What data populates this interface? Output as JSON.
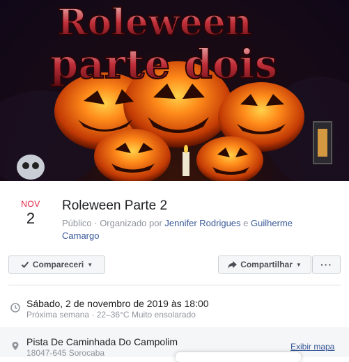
{
  "cover": {
    "title_line1": "Roleween",
    "title_line2": "parte dois"
  },
  "event": {
    "month": "NOV",
    "day": "2",
    "title": "Roleween Parte 2",
    "privacy": "Público · Organizado por ",
    "host1": "Jennifer Rodrigues",
    "and": " e ",
    "host2": "Guilherme Camargo"
  },
  "actions": {
    "going_label": "Compareceri",
    "share_label": "Compartilhar",
    "more_label": "···"
  },
  "details": {
    "datetime": "Sábado, 2 de novembro de 2019 às 18:00",
    "weather": "Próxima semana · 22–36°C Muito ensolarado",
    "location_name": "Pista De Caminhada Do Campolim",
    "location_address": "18047-645 Sorocaba",
    "map_link": "Exibir mapa"
  },
  "colors": {
    "accent": "#385898",
    "month": "#e41e3f",
    "muted": "#90949c"
  }
}
